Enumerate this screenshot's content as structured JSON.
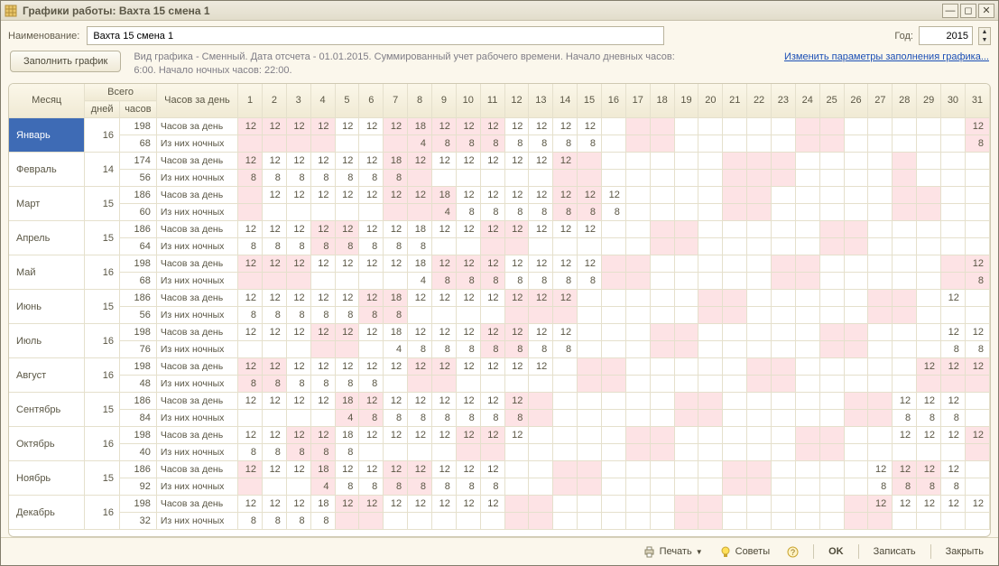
{
  "window": {
    "title": "Графики работы: Вахта 15 смена 1"
  },
  "form": {
    "name_label": "Наименование:",
    "name_value": "Вахта 15 смена 1",
    "year_label": "Год:",
    "year_value": "2015",
    "fill_button": "Заполнить график",
    "description": "Вид графика - Сменный. Дата отсчета - 01.01.2015. Суммированный учет рабочего времени. Начало дневных часов: 6:00. Начало ночных часов: 22:00.",
    "change_link": "Изменить параметры заполнения графика..."
  },
  "headers": {
    "month": "Месяц",
    "total": "Всего",
    "days": "дней",
    "hours": "часов",
    "hours_per_day": "Часов за день",
    "row_hours": "Часов за день",
    "row_night": "Из них ночных"
  },
  "footer": {
    "print": "Печать",
    "tips": "Советы",
    "ok": "OK",
    "save": "Записать",
    "close": "Закрыть"
  },
  "pink_days": {
    "1": [
      1,
      2,
      3,
      4,
      7,
      8,
      9,
      10,
      11,
      17,
      18,
      24,
      25,
      31
    ],
    "2": [
      1,
      7,
      8,
      14,
      15,
      21,
      22,
      23,
      28
    ],
    "3": [
      1,
      7,
      8,
      9,
      14,
      15,
      21,
      22,
      28,
      29
    ],
    "4": [
      4,
      5,
      11,
      12,
      18,
      19,
      25,
      26
    ],
    "5": [
      1,
      2,
      3,
      9,
      10,
      11,
      16,
      17,
      23,
      24,
      30,
      31
    ],
    "6": [
      6,
      7,
      12,
      13,
      14,
      20,
      21,
      27,
      28
    ],
    "7": [
      4,
      5,
      11,
      12,
      18,
      19,
      25,
      26
    ],
    "8": [
      1,
      2,
      8,
      9,
      15,
      16,
      22,
      23,
      29,
      30,
      31
    ],
    "9": [
      5,
      6,
      12,
      13,
      19,
      20,
      26,
      27
    ],
    "10": [
      3,
      4,
      10,
      11,
      17,
      18,
      24,
      25,
      31
    ],
    "11": [
      1,
      4,
      7,
      8,
      14,
      15,
      21,
      22,
      28,
      29
    ],
    "12": [
      5,
      6,
      12,
      13,
      19,
      20,
      26,
      27
    ]
  },
  "months": [
    {
      "name": "Январь",
      "days": 16,
      "hours": 198,
      "night": 68,
      "h": {
        "1": 12,
        "2": 12,
        "3": 12,
        "4": 12,
        "5": 12,
        "6": 12,
        "7": 12,
        "8": 18,
        "9": 12,
        "10": 12,
        "11": 12,
        "12": 12,
        "13": 12,
        "14": 12,
        "15": 12,
        "31": 12
      },
      "n": {
        "8": 4,
        "9": 8,
        "10": 8,
        "11": 8,
        "12": 8,
        "13": 8,
        "14": 8,
        "15": 8,
        "31": 8
      }
    },
    {
      "name": "Февраль",
      "days": 14,
      "hours": 174,
      "night": 56,
      "h": {
        "1": 12,
        "2": 12,
        "3": 12,
        "4": 12,
        "5": 12,
        "6": 12,
        "7": 18,
        "8": 12,
        "9": 12,
        "10": 12,
        "11": 12,
        "12": 12,
        "13": 12,
        "14": 12
      },
      "n": {
        "1": 8,
        "2": 8,
        "3": 8,
        "4": 8,
        "5": 8,
        "6": 8,
        "7": 8
      }
    },
    {
      "name": "Март",
      "days": 15,
      "hours": 186,
      "night": 60,
      "h": {
        "2": 12,
        "3": 12,
        "4": 12,
        "5": 12,
        "6": 12,
        "7": 12,
        "8": 12,
        "9": 18,
        "10": 12,
        "11": 12,
        "12": 12,
        "13": 12,
        "14": 12,
        "15": 12,
        "16": 12
      },
      "n": {
        "9": 4,
        "10": 8,
        "11": 8,
        "12": 8,
        "13": 8,
        "14": 8,
        "15": 8,
        "16": 8
      }
    },
    {
      "name": "Апрель",
      "days": 15,
      "hours": 186,
      "night": 64,
      "h": {
        "1": 12,
        "2": 12,
        "3": 12,
        "4": 12,
        "5": 12,
        "6": 12,
        "7": 12,
        "8": 18,
        "9": 12,
        "10": 12,
        "11": 12,
        "12": 12,
        "13": 12,
        "14": 12,
        "15": 12
      },
      "n": {
        "1": 8,
        "2": 8,
        "3": 8,
        "4": 8,
        "5": 8,
        "6": 8,
        "7": 8,
        "8": 8
      }
    },
    {
      "name": "Май",
      "days": 16,
      "hours": 198,
      "night": 68,
      "h": {
        "1": 12,
        "2": 12,
        "3": 12,
        "4": 12,
        "5": 12,
        "6": 12,
        "7": 12,
        "8": 18,
        "9": 12,
        "10": 12,
        "11": 12,
        "12": 12,
        "13": 12,
        "14": 12,
        "15": 12,
        "31": 12
      },
      "n": {
        "8": 4,
        "9": 8,
        "10": 8,
        "11": 8,
        "12": 8,
        "13": 8,
        "14": 8,
        "15": 8,
        "31": 8
      }
    },
    {
      "name": "Июнь",
      "days": 15,
      "hours": 186,
      "night": 56,
      "h": {
        "1": 12,
        "2": 12,
        "3": 12,
        "4": 12,
        "5": 12,
        "6": 12,
        "7": 18,
        "8": 12,
        "9": 12,
        "10": 12,
        "11": 12,
        "12": 12,
        "13": 12,
        "14": 12,
        "30": 12
      },
      "n": {
        "1": 8,
        "2": 8,
        "3": 8,
        "4": 8,
        "5": 8,
        "6": 8,
        "7": 8
      }
    },
    {
      "name": "Июль",
      "days": 16,
      "hours": 198,
      "night": 76,
      "h": {
        "1": 12,
        "2": 12,
        "3": 12,
        "4": 12,
        "5": 12,
        "6": 12,
        "7": 18,
        "8": 12,
        "9": 12,
        "10": 12,
        "11": 12,
        "12": 12,
        "13": 12,
        "14": 12,
        "30": 12,
        "31": 12
      },
      "n": {
        "7": 4,
        "8": 8,
        "9": 8,
        "10": 8,
        "11": 8,
        "12": 8,
        "13": 8,
        "14": 8,
        "30": 8,
        "31": 8
      }
    },
    {
      "name": "Август",
      "days": 16,
      "hours": 198,
      "night": 48,
      "h": {
        "1": 12,
        "2": 12,
        "3": 12,
        "4": 12,
        "5": 12,
        "6": 12,
        "7": 12,
        "8": 12,
        "9": 12,
        "10": 12,
        "11": 12,
        "12": 12,
        "13": 12,
        "29": 12,
        "30": 12,
        "31": 12
      },
      "n": {
        "1": 8,
        "2": 8,
        "3": 8,
        "4": 8,
        "5": 8,
        "6": 8
      }
    },
    {
      "name": "Сентябрь",
      "days": 15,
      "hours": 186,
      "night": 84,
      "h": {
        "1": 12,
        "2": 12,
        "3": 12,
        "4": 12,
        "5": 18,
        "6": 12,
        "7": 12,
        "8": 12,
        "9": 12,
        "10": 12,
        "11": 12,
        "12": 12,
        "28": 12,
        "29": 12,
        "30": 12
      },
      "n": {
        "5": 4,
        "6": 8,
        "7": 8,
        "8": 8,
        "9": 8,
        "10": 8,
        "11": 8,
        "12": 8,
        "28": 8,
        "29": 8,
        "30": 8
      }
    },
    {
      "name": "Октябрь",
      "days": 16,
      "hours": 198,
      "night": 40,
      "h": {
        "1": 12,
        "2": 12,
        "3": 12,
        "4": 12,
        "5": 18,
        "6": 12,
        "7": 12,
        "8": 12,
        "9": 12,
        "10": 12,
        "11": 12,
        "12": 12,
        "28": 12,
        "29": 12,
        "30": 12,
        "31": 12
      },
      "n": {
        "1": 8,
        "2": 8,
        "3": 8,
        "4": 8,
        "5": 8
      }
    },
    {
      "name": "Ноябрь",
      "days": 15,
      "hours": 186,
      "night": 92,
      "h": {
        "1": 12,
        "2": 12,
        "3": 12,
        "4": 18,
        "5": 12,
        "6": 12,
        "7": 12,
        "8": 12,
        "9": 12,
        "10": 12,
        "11": 12,
        "27": 12,
        "28": 12,
        "29": 12,
        "30": 12
      },
      "n": {
        "4": 4,
        "5": 8,
        "6": 8,
        "7": 8,
        "8": 8,
        "9": 8,
        "10": 8,
        "11": 8,
        "27": 8,
        "28": 8,
        "29": 8,
        "30": 8
      }
    },
    {
      "name": "Декабрь",
      "days": 16,
      "hours": 198,
      "night": 32,
      "h": {
        "1": 12,
        "2": 12,
        "3": 12,
        "4": 18,
        "5": 12,
        "6": 12,
        "7": 12,
        "8": 12,
        "9": 12,
        "10": 12,
        "11": 12,
        "27": 12,
        "28": 12,
        "29": 12,
        "30": 12,
        "31": 12
      },
      "n": {
        "1": 8,
        "2": 8,
        "3": 8,
        "4": 8
      }
    }
  ]
}
